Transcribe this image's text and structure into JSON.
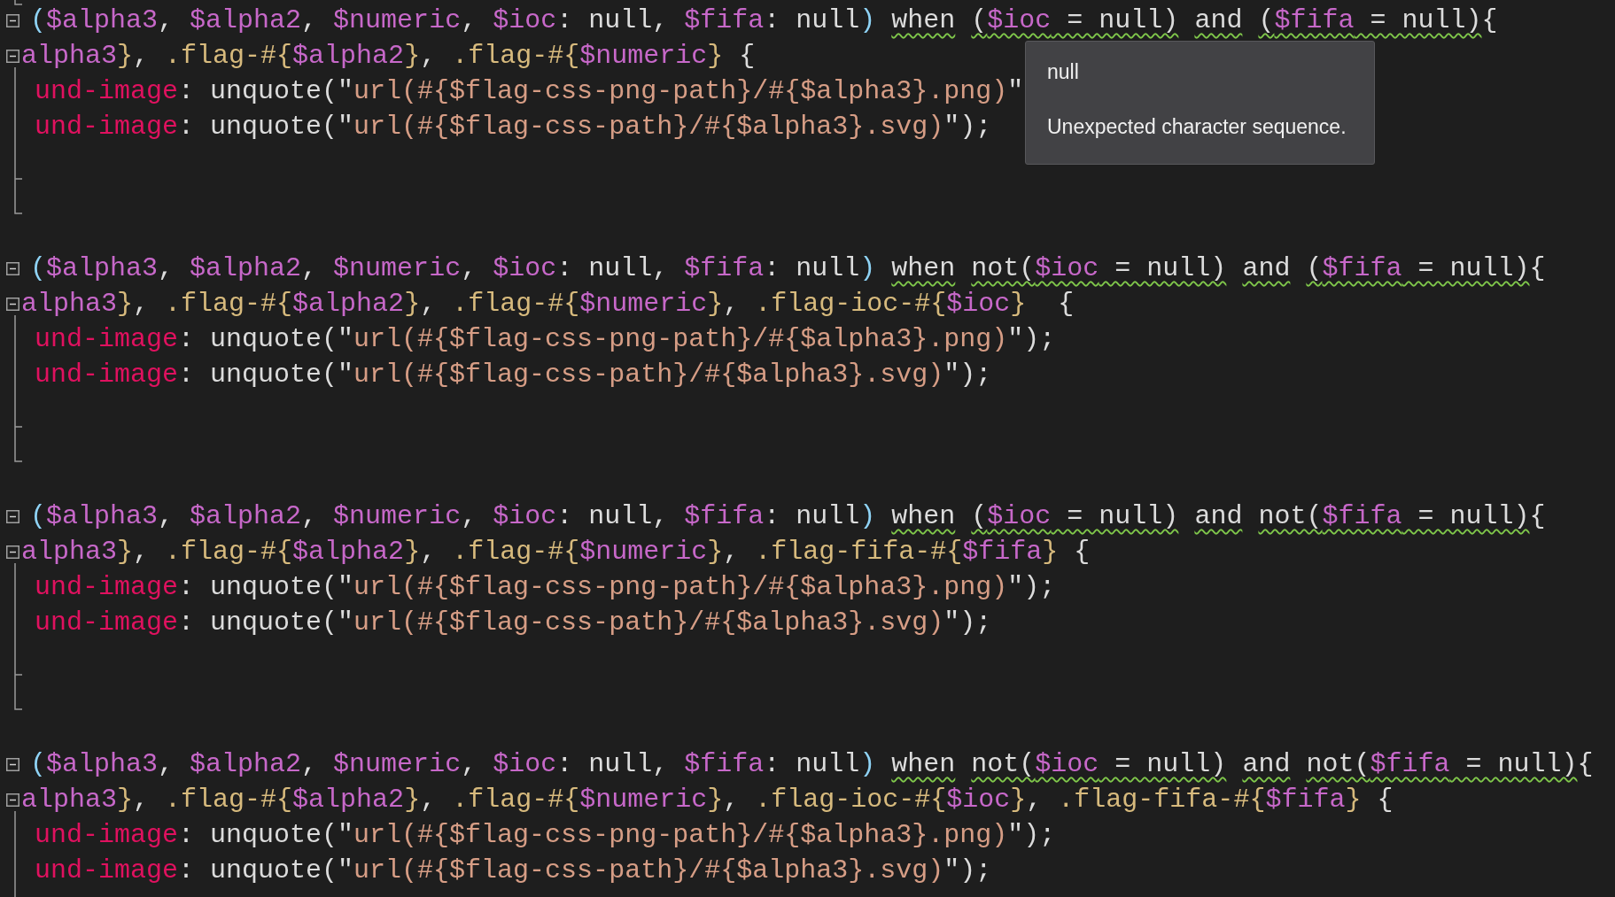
{
  "editor": {
    "blocks": [
      {
        "fold_expanded": true,
        "lines": [
          [
            {
              "text": "(",
              "kind": "paren",
              "squiggle": false
            },
            {
              "text": "$alpha3",
              "kind": "variable",
              "squiggle": false
            },
            {
              "text": ", ",
              "kind": "plain",
              "squiggle": false
            },
            {
              "text": "$alpha2",
              "kind": "variable",
              "squiggle": false
            },
            {
              "text": ", ",
              "kind": "plain",
              "squiggle": false
            },
            {
              "text": "$numeric",
              "kind": "variable",
              "squiggle": false
            },
            {
              "text": ", ",
              "kind": "plain",
              "squiggle": false
            },
            {
              "text": "$ioc",
              "kind": "variable",
              "squiggle": false
            },
            {
              "text": ": null, ",
              "kind": "plain",
              "squiggle": false
            },
            {
              "text": "$fifa",
              "kind": "variable",
              "squiggle": false
            },
            {
              "text": ": null",
              "kind": "plain",
              "squiggle": false
            },
            {
              "text": ") ",
              "kind": "paren",
              "squiggle": false
            },
            {
              "text": "when ",
              "kind": "plain",
              "squiggle": true
            },
            {
              "text": "(",
              "kind": "plain",
              "squiggle": true
            },
            {
              "text": "$ioc",
              "kind": "variable",
              "squiggle": true
            },
            {
              "text": " = null) ",
              "kind": "plain",
              "squiggle": true
            },
            {
              "text": "and ",
              "kind": "plain",
              "squiggle": true
            },
            {
              "text": "(",
              "kind": "plain",
              "squiggle": true
            },
            {
              "text": "$fifa",
              "kind": "variable",
              "squiggle": true
            },
            {
              "text": " = null)",
              "kind": "plain",
              "squiggle": true
            },
            {
              "text": "{",
              "kind": "plain",
              "squiggle": false
            }
          ],
          [
            {
              "text": "alpha3",
              "kind": "variable",
              "squiggle": false
            },
            {
              "text": "}",
              "kind": "selector",
              "squiggle": false
            },
            {
              "text": ", ",
              "kind": "plain",
              "squiggle": false
            },
            {
              "text": ".flag-#{",
              "kind": "selector",
              "squiggle": false
            },
            {
              "text": "$alpha2",
              "kind": "variable",
              "squiggle": false
            },
            {
              "text": "}",
              "kind": "selector",
              "squiggle": false
            },
            {
              "text": ", ",
              "kind": "plain",
              "squiggle": false
            },
            {
              "text": ".flag-#{",
              "kind": "selector",
              "squiggle": false
            },
            {
              "text": "$numeric",
              "kind": "variable",
              "squiggle": false
            },
            {
              "text": "}",
              "kind": "selector",
              "squiggle": false
            },
            {
              "text": " {",
              "kind": "plain",
              "squiggle": false
            }
          ],
          [
            {
              "text": "und-image",
              "kind": "property",
              "squiggle": false
            },
            {
              "text": ": unquote(\"",
              "kind": "plain",
              "squiggle": false
            },
            {
              "text": "url(#{$flag-css-png-path}/#{$alpha3}.png)",
              "kind": "string",
              "squiggle": false
            },
            {
              "text": "\"",
              "kind": "plain",
              "squiggle": false
            }
          ],
          [
            {
              "text": "und-image",
              "kind": "property",
              "squiggle": false
            },
            {
              "text": ": unquote(\"",
              "kind": "plain",
              "squiggle": false
            },
            {
              "text": "url(#{$flag-css-path}/#{$alpha3}.svg)",
              "kind": "string",
              "squiggle": false
            },
            {
              "text": "\");",
              "kind": "plain",
              "squiggle": false
            }
          ]
        ]
      },
      {
        "fold_expanded": true,
        "lines": [
          [
            {
              "text": "(",
              "kind": "paren",
              "squiggle": false
            },
            {
              "text": "$alpha3",
              "kind": "variable",
              "squiggle": false
            },
            {
              "text": ", ",
              "kind": "plain",
              "squiggle": false
            },
            {
              "text": "$alpha2",
              "kind": "variable",
              "squiggle": false
            },
            {
              "text": ", ",
              "kind": "plain",
              "squiggle": false
            },
            {
              "text": "$numeric",
              "kind": "variable",
              "squiggle": false
            },
            {
              "text": ", ",
              "kind": "plain",
              "squiggle": false
            },
            {
              "text": "$ioc",
              "kind": "variable",
              "squiggle": false
            },
            {
              "text": ": null, ",
              "kind": "plain",
              "squiggle": false
            },
            {
              "text": "$fifa",
              "kind": "variable",
              "squiggle": false
            },
            {
              "text": ": null",
              "kind": "plain",
              "squiggle": false
            },
            {
              "text": ") ",
              "kind": "paren",
              "squiggle": false
            },
            {
              "text": "when ",
              "kind": "plain",
              "squiggle": true
            },
            {
              "text": "not(",
              "kind": "plain",
              "squiggle": true
            },
            {
              "text": "$ioc",
              "kind": "variable",
              "squiggle": true
            },
            {
              "text": " = null) ",
              "kind": "plain",
              "squiggle": true
            },
            {
              "text": "and ",
              "kind": "plain",
              "squiggle": true
            },
            {
              "text": "(",
              "kind": "plain",
              "squiggle": true
            },
            {
              "text": "$fifa",
              "kind": "variable",
              "squiggle": true
            },
            {
              "text": " = null)",
              "kind": "plain",
              "squiggle": true
            },
            {
              "text": "{",
              "kind": "plain",
              "squiggle": false
            }
          ],
          [
            {
              "text": "alpha3",
              "kind": "variable",
              "squiggle": false
            },
            {
              "text": "}",
              "kind": "selector",
              "squiggle": false
            },
            {
              "text": ", ",
              "kind": "plain",
              "squiggle": false
            },
            {
              "text": ".flag-#{",
              "kind": "selector",
              "squiggle": false
            },
            {
              "text": "$alpha2",
              "kind": "variable",
              "squiggle": false
            },
            {
              "text": "}",
              "kind": "selector",
              "squiggle": false
            },
            {
              "text": ", ",
              "kind": "plain",
              "squiggle": false
            },
            {
              "text": ".flag-#{",
              "kind": "selector",
              "squiggle": false
            },
            {
              "text": "$numeric",
              "kind": "variable",
              "squiggle": false
            },
            {
              "text": "}",
              "kind": "selector",
              "squiggle": false
            },
            {
              "text": ", ",
              "kind": "plain",
              "squiggle": false
            },
            {
              "text": ".flag-ioc-#{",
              "kind": "selector",
              "squiggle": false
            },
            {
              "text": "$ioc",
              "kind": "variable",
              "squiggle": false
            },
            {
              "text": "}",
              "kind": "selector",
              "squiggle": false
            },
            {
              "text": "  {",
              "kind": "plain",
              "squiggle": false
            }
          ],
          [
            {
              "text": "und-image",
              "kind": "property",
              "squiggle": false
            },
            {
              "text": ": unquote(\"",
              "kind": "plain",
              "squiggle": false
            },
            {
              "text": "url(#{$flag-css-png-path}/#{$alpha3}.png)",
              "kind": "string",
              "squiggle": false
            },
            {
              "text": "\");",
              "kind": "plain",
              "squiggle": false
            }
          ],
          [
            {
              "text": "und-image",
              "kind": "property",
              "squiggle": false
            },
            {
              "text": ": unquote(\"",
              "kind": "plain",
              "squiggle": false
            },
            {
              "text": "url(#{$flag-css-path}/#{$alpha3}.svg)",
              "kind": "string",
              "squiggle": false
            },
            {
              "text": "\");",
              "kind": "plain",
              "squiggle": false
            }
          ]
        ]
      },
      {
        "fold_expanded": true,
        "lines": [
          [
            {
              "text": "(",
              "kind": "paren",
              "squiggle": false
            },
            {
              "text": "$alpha3",
              "kind": "variable",
              "squiggle": false
            },
            {
              "text": ", ",
              "kind": "plain",
              "squiggle": false
            },
            {
              "text": "$alpha2",
              "kind": "variable",
              "squiggle": false
            },
            {
              "text": ", ",
              "kind": "plain",
              "squiggle": false
            },
            {
              "text": "$numeric",
              "kind": "variable",
              "squiggle": false
            },
            {
              "text": ", ",
              "kind": "plain",
              "squiggle": false
            },
            {
              "text": "$ioc",
              "kind": "variable",
              "squiggle": false
            },
            {
              "text": ": null, ",
              "kind": "plain",
              "squiggle": false
            },
            {
              "text": "$fifa",
              "kind": "variable",
              "squiggle": false
            },
            {
              "text": ": null",
              "kind": "plain",
              "squiggle": false
            },
            {
              "text": ") ",
              "kind": "paren",
              "squiggle": false
            },
            {
              "text": "when ",
              "kind": "plain",
              "squiggle": true
            },
            {
              "text": "(",
              "kind": "plain",
              "squiggle": true
            },
            {
              "text": "$ioc",
              "kind": "variable",
              "squiggle": true
            },
            {
              "text": " = null) ",
              "kind": "plain",
              "squiggle": true
            },
            {
              "text": "and ",
              "kind": "plain",
              "squiggle": true
            },
            {
              "text": "not(",
              "kind": "plain",
              "squiggle": true
            },
            {
              "text": "$fifa",
              "kind": "variable",
              "squiggle": true
            },
            {
              "text": " = null)",
              "kind": "plain",
              "squiggle": true
            },
            {
              "text": "{",
              "kind": "plain",
              "squiggle": false
            }
          ],
          [
            {
              "text": "alpha3",
              "kind": "variable",
              "squiggle": false
            },
            {
              "text": "}",
              "kind": "selector",
              "squiggle": false
            },
            {
              "text": ", ",
              "kind": "plain",
              "squiggle": false
            },
            {
              "text": ".flag-#{",
              "kind": "selector",
              "squiggle": false
            },
            {
              "text": "$alpha2",
              "kind": "variable",
              "squiggle": false
            },
            {
              "text": "}",
              "kind": "selector",
              "squiggle": false
            },
            {
              "text": ", ",
              "kind": "plain",
              "squiggle": false
            },
            {
              "text": ".flag-#{",
              "kind": "selector",
              "squiggle": false
            },
            {
              "text": "$numeric",
              "kind": "variable",
              "squiggle": false
            },
            {
              "text": "}",
              "kind": "selector",
              "squiggle": false
            },
            {
              "text": ", ",
              "kind": "plain",
              "squiggle": false
            },
            {
              "text": ".flag-fifa-#{",
              "kind": "selector",
              "squiggle": false
            },
            {
              "text": "$fifa",
              "kind": "variable",
              "squiggle": false
            },
            {
              "text": "}",
              "kind": "selector",
              "squiggle": false
            },
            {
              "text": " {",
              "kind": "plain",
              "squiggle": false
            }
          ],
          [
            {
              "text": "und-image",
              "kind": "property",
              "squiggle": false
            },
            {
              "text": ": unquote(\"",
              "kind": "plain",
              "squiggle": false
            },
            {
              "text": "url(#{$flag-css-png-path}/#{$alpha3}.png)",
              "kind": "string",
              "squiggle": false
            },
            {
              "text": "\");",
              "kind": "plain",
              "squiggle": false
            }
          ],
          [
            {
              "text": "und-image",
              "kind": "property",
              "squiggle": false
            },
            {
              "text": ": unquote(\"",
              "kind": "plain",
              "squiggle": false
            },
            {
              "text": "url(#{$flag-css-path}/#{$alpha3}.svg)",
              "kind": "string",
              "squiggle": false
            },
            {
              "text": "\");",
              "kind": "plain",
              "squiggle": false
            }
          ]
        ]
      },
      {
        "fold_expanded": true,
        "lines": [
          [
            {
              "text": "(",
              "kind": "paren",
              "squiggle": false
            },
            {
              "text": "$alpha3",
              "kind": "variable",
              "squiggle": false
            },
            {
              "text": ", ",
              "kind": "plain",
              "squiggle": false
            },
            {
              "text": "$alpha2",
              "kind": "variable",
              "squiggle": false
            },
            {
              "text": ", ",
              "kind": "plain",
              "squiggle": false
            },
            {
              "text": "$numeric",
              "kind": "variable",
              "squiggle": false
            },
            {
              "text": ", ",
              "kind": "plain",
              "squiggle": false
            },
            {
              "text": "$ioc",
              "kind": "variable",
              "squiggle": false
            },
            {
              "text": ": null, ",
              "kind": "plain",
              "squiggle": false
            },
            {
              "text": "$fifa",
              "kind": "variable",
              "squiggle": false
            },
            {
              "text": ": null",
              "kind": "plain",
              "squiggle": false
            },
            {
              "text": ") ",
              "kind": "paren",
              "squiggle": false
            },
            {
              "text": "when ",
              "kind": "plain",
              "squiggle": true
            },
            {
              "text": "not(",
              "kind": "plain",
              "squiggle": true
            },
            {
              "text": "$ioc",
              "kind": "variable",
              "squiggle": true
            },
            {
              "text": " = null) ",
              "kind": "plain",
              "squiggle": true
            },
            {
              "text": "and ",
              "kind": "plain",
              "squiggle": true
            },
            {
              "text": "not(",
              "kind": "plain",
              "squiggle": true
            },
            {
              "text": "$fifa",
              "kind": "variable",
              "squiggle": true
            },
            {
              "text": " = null)",
              "kind": "plain",
              "squiggle": true
            },
            {
              "text": "{",
              "kind": "plain",
              "squiggle": false
            }
          ],
          [
            {
              "text": "alpha3",
              "kind": "variable",
              "squiggle": false
            },
            {
              "text": "}",
              "kind": "selector",
              "squiggle": false
            },
            {
              "text": ", ",
              "kind": "plain",
              "squiggle": false
            },
            {
              "text": ".flag-#{",
              "kind": "selector",
              "squiggle": false
            },
            {
              "text": "$alpha2",
              "kind": "variable",
              "squiggle": false
            },
            {
              "text": "}",
              "kind": "selector",
              "squiggle": false
            },
            {
              "text": ", ",
              "kind": "plain",
              "squiggle": false
            },
            {
              "text": ".flag-#{",
              "kind": "selector",
              "squiggle": false
            },
            {
              "text": "$numeric",
              "kind": "variable",
              "squiggle": false
            },
            {
              "text": "}",
              "kind": "selector",
              "squiggle": false
            },
            {
              "text": ", ",
              "kind": "plain",
              "squiggle": false
            },
            {
              "text": ".flag-ioc-#{",
              "kind": "selector",
              "squiggle": false
            },
            {
              "text": "$ioc",
              "kind": "variable",
              "squiggle": false
            },
            {
              "text": "}",
              "kind": "selector",
              "squiggle": false
            },
            {
              "text": ", ",
              "kind": "plain",
              "squiggle": false
            },
            {
              "text": ".flag-fifa-#{",
              "kind": "selector",
              "squiggle": false
            },
            {
              "text": "$fifa",
              "kind": "variable",
              "squiggle": false
            },
            {
              "text": "}",
              "kind": "selector",
              "squiggle": false
            },
            {
              "text": " {",
              "kind": "plain",
              "squiggle": false
            }
          ],
          [
            {
              "text": "und-image",
              "kind": "property",
              "squiggle": false
            },
            {
              "text": ": unquote(\"",
              "kind": "plain",
              "squiggle": false
            },
            {
              "text": "url(#{$flag-css-png-path}/#{$alpha3}.png)",
              "kind": "string",
              "squiggle": false
            },
            {
              "text": "\");",
              "kind": "plain",
              "squiggle": false
            }
          ],
          [
            {
              "text": "und-image",
              "kind": "property",
              "squiggle": false
            },
            {
              "text": ": unquote(\"",
              "kind": "plain",
              "squiggle": false
            },
            {
              "text": "url(#{$flag-css-path}/#{$alpha3}.svg)",
              "kind": "string",
              "squiggle": false
            },
            {
              "text": "\");",
              "kind": "plain",
              "squiggle": false
            }
          ]
        ]
      }
    ]
  },
  "tooltip": {
    "title": "null",
    "message": "Unexpected character sequence."
  }
}
